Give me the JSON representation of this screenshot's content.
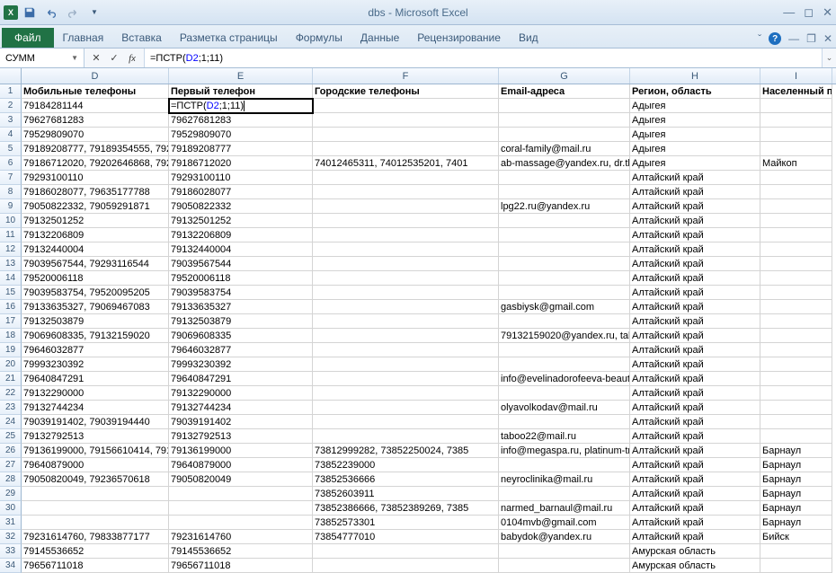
{
  "title": "dbs  -  Microsoft Excel",
  "ribbon": {
    "file": "Файл",
    "tabs": [
      "Главная",
      "Вставка",
      "Разметка страницы",
      "Формулы",
      "Данные",
      "Рецензирование",
      "Вид"
    ]
  },
  "namebox": "СУММ",
  "formula": "=ПСТР(D2;1;11)",
  "columns": [
    {
      "letter": "D",
      "cls": "cD"
    },
    {
      "letter": "E",
      "cls": "cE"
    },
    {
      "letter": "F",
      "cls": "cF"
    },
    {
      "letter": "G",
      "cls": "cG"
    },
    {
      "letter": "H",
      "cls": "cH"
    },
    {
      "letter": "I",
      "cls": "cI"
    }
  ],
  "headers": {
    "D": "Мобильные телефоны",
    "E": "Первый телефон",
    "F": "Городские телефоны",
    "G": "Email-адреса",
    "H": "Регион, область",
    "I": "Населенный пункт"
  },
  "rows": [
    {
      "n": 2,
      "D": "79184281144",
      "E": "=ПСТР(D2;1;11)",
      "F": "",
      "G": "",
      "H": "Адыгея",
      "I": "",
      "active": true
    },
    {
      "n": 3,
      "D": "79627681283",
      "E": "79627681283",
      "F": "",
      "G": "",
      "H": "Адыгея",
      "I": ""
    },
    {
      "n": 4,
      "D": "79529809070",
      "E": "79529809070",
      "F": "",
      "G": "",
      "H": "Адыгея",
      "I": ""
    },
    {
      "n": 5,
      "D": "79189208777, 79189354555, 7928",
      "E": "79189208777",
      "F": "",
      "G": "coral-family@mail.ru",
      "H": "Адыгея",
      "I": ""
    },
    {
      "n": 6,
      "D": "79186712020, 79202646868, 7921",
      "E": "79186712020",
      "F": "74012465311, 74012535201, 7401",
      "G": "ab-massage@yandex.ru, dr.tkac",
      "H": "Адыгея",
      "I": "Майкоп"
    },
    {
      "n": 7,
      "D": "79293100110",
      "E": "79293100110",
      "F": "",
      "G": "",
      "H": "Алтайский край",
      "I": ""
    },
    {
      "n": 8,
      "D": "79186028077, 79635177788",
      "E": "79186028077",
      "F": "",
      "G": "",
      "H": "Алтайский край",
      "I": ""
    },
    {
      "n": 9,
      "D": "79050822332, 79059291871",
      "E": "79050822332",
      "F": "",
      "G": "lpg22.ru@yandex.ru",
      "H": "Алтайский край",
      "I": ""
    },
    {
      "n": 10,
      "D": "79132501252",
      "E": "79132501252",
      "F": "",
      "G": "",
      "H": "Алтайский край",
      "I": ""
    },
    {
      "n": 11,
      "D": "79132206809",
      "E": "79132206809",
      "F": "",
      "G": "",
      "H": "Алтайский край",
      "I": ""
    },
    {
      "n": 12,
      "D": "79132440004",
      "E": "79132440004",
      "F": "",
      "G": "",
      "H": "Алтайский край",
      "I": ""
    },
    {
      "n": 13,
      "D": "79039567544, 79293116544",
      "E": "79039567544",
      "F": "",
      "G": "",
      "H": "Алтайский край",
      "I": ""
    },
    {
      "n": 14,
      "D": "79520006118",
      "E": "79520006118",
      "F": "",
      "G": "",
      "H": "Алтайский край",
      "I": ""
    },
    {
      "n": 15,
      "D": "79039583754, 79520095205",
      "E": "79039583754",
      "F": "",
      "G": "",
      "H": "Алтайский край",
      "I": ""
    },
    {
      "n": 16,
      "D": "79133635327, 79069467083",
      "E": "79133635327",
      "F": "",
      "G": "gasbiysk@gmail.com",
      "H": "Алтайский край",
      "I": ""
    },
    {
      "n": 17,
      "D": "79132503879",
      "E": "79132503879",
      "F": "",
      "G": "",
      "H": "Алтайский край",
      "I": ""
    },
    {
      "n": 18,
      "D": "79069608335, 79132159020",
      "E": "79069608335",
      "F": "",
      "G": "79132159020@yandex.ru, talato",
      "H": "Алтайский край",
      "I": ""
    },
    {
      "n": 19,
      "D": "79646032877",
      "E": "79646032877",
      "F": "",
      "G": "",
      "H": "Алтайский край",
      "I": ""
    },
    {
      "n": 20,
      "D": "79993230392",
      "E": "79993230392",
      "F": "",
      "G": "",
      "H": "Алтайский край",
      "I": ""
    },
    {
      "n": 21,
      "D": "79640847291",
      "E": "79640847291",
      "F": "",
      "G": "info@evelinadorofeeva-beauty",
      "H": "Алтайский край",
      "I": ""
    },
    {
      "n": 22,
      "D": "79132290000",
      "E": "79132290000",
      "F": "",
      "G": "",
      "H": "Алтайский край",
      "I": ""
    },
    {
      "n": 23,
      "D": "79132744234",
      "E": "79132744234",
      "F": "",
      "G": "olyavolkodav@mail.ru",
      "H": "Алтайский край",
      "I": ""
    },
    {
      "n": 24,
      "D": "79039191402, 79039194440",
      "E": "79039191402",
      "F": "",
      "G": "",
      "H": "Алтайский край",
      "I": ""
    },
    {
      "n": 25,
      "D": "79132792513",
      "E": "79132792513",
      "F": "",
      "G": "taboo22@mail.ru",
      "H": "Алтайский край",
      "I": ""
    },
    {
      "n": 26,
      "D": "79136199000, 79156610414, 7919",
      "E": "79136199000",
      "F": "73812999282, 73852250024, 7385",
      "G": "info@megaspa.ru, platinum-tm",
      "H": "Алтайский край",
      "I": "Барнаул"
    },
    {
      "n": 27,
      "D": "79640879000",
      "E": "79640879000",
      "F": "73852239000",
      "G": "",
      "H": "Алтайский край",
      "I": "Барнаул"
    },
    {
      "n": 28,
      "D": "79050820049, 79236570618",
      "E": "79050820049",
      "F": "73852536666",
      "G": "neyroclinika@mail.ru",
      "H": "Алтайский край",
      "I": "Барнаул"
    },
    {
      "n": 29,
      "D": "",
      "E": "",
      "F": "73852603911",
      "G": "",
      "H": "Алтайский край",
      "I": "Барнаул"
    },
    {
      "n": 30,
      "D": "",
      "E": "",
      "F": "73852386666, 73852389269, 7385",
      "G": "narmed_barnaul@mail.ru",
      "H": "Алтайский край",
      "I": "Барнаул"
    },
    {
      "n": 31,
      "D": "",
      "E": "",
      "F": "73852573301",
      "G": "0104mvb@gmail.com",
      "H": "Алтайский край",
      "I": "Барнаул"
    },
    {
      "n": 32,
      "D": "79231614760, 79833877177",
      "E": "79231614760",
      "F": "73854777010",
      "G": "babydok@yandex.ru",
      "H": "Алтайский край",
      "I": "Бийск"
    },
    {
      "n": 33,
      "D": "79145536652",
      "E": "79145536652",
      "F": "",
      "G": "",
      "H": "Амурская область",
      "I": ""
    },
    {
      "n": 34,
      "D": "79656711018",
      "E": "79656711018",
      "F": "",
      "G": "",
      "H": "Амурская область",
      "I": ""
    }
  ]
}
